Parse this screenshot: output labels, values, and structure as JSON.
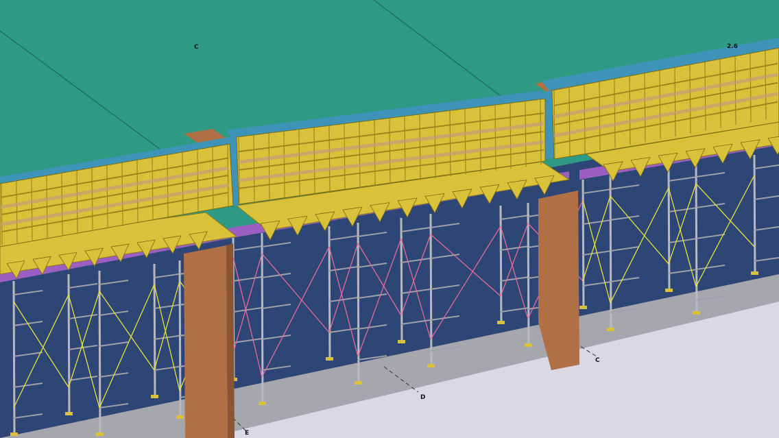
{
  "labels": {
    "top_c": "C",
    "top_right": "2.6",
    "ground_c": "C",
    "ground_d": "D",
    "ground_e": "E"
  },
  "colors": {
    "slab": "#2f9a83",
    "wall": "#2e4676",
    "floor": "#d9d8e3",
    "curb": "#a6a6ad",
    "formwork": "#d9c23a",
    "beam_side": "#3d93b8",
    "column": "#b06f45",
    "purple_joist": "#9a5fc0",
    "prop": "#a9a9b0",
    "brace_yellow": "#e6e43a",
    "brace_pink": "#e66b9a"
  }
}
